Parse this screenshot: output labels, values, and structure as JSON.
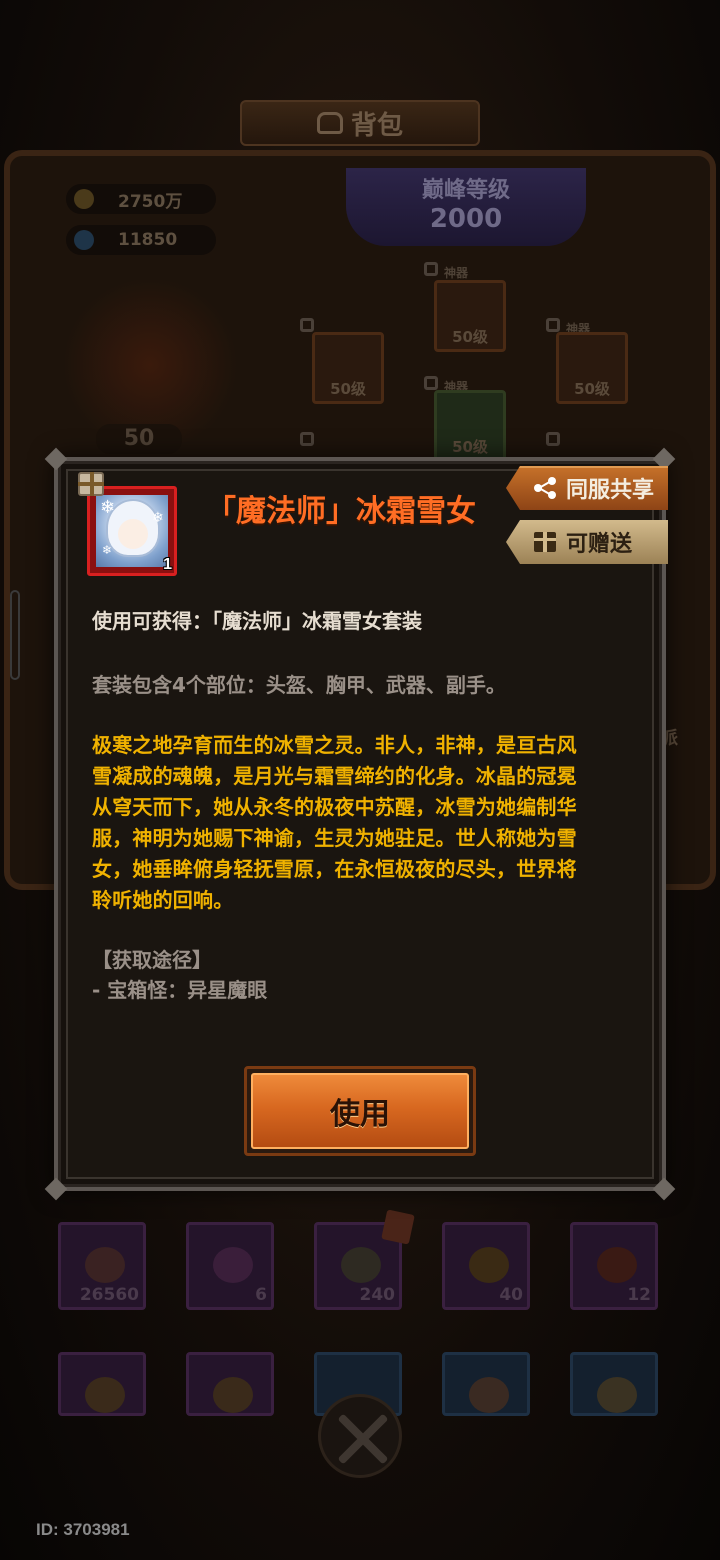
{
  "background": {
    "title": "背包",
    "currency": {
      "gold": "2750万",
      "gems": "11850"
    },
    "peak_level": {
      "label": "巅峰等级",
      "value": "2000"
    },
    "hero_level": "50",
    "equipment_slots": [
      {
        "tag": "神器",
        "level": "50级"
      },
      {
        "tag": "",
        "level": "50级"
      },
      {
        "tag": "神器",
        "level": "50级"
      },
      {
        "tag": "神器",
        "level": "50级"
      },
      {
        "tag": "",
        "level": "50级"
      }
    ],
    "side_text": "派",
    "inventory": [
      {
        "count": "26560",
        "kind": "purple"
      },
      {
        "count": "6",
        "kind": "purple"
      },
      {
        "count": "240",
        "kind": "purple"
      },
      {
        "count": "40",
        "kind": "purple"
      },
      {
        "count": "12",
        "kind": "purple"
      }
    ],
    "player_id": "ID: 3703981"
  },
  "dialog": {
    "item_title": "「魔法师」冰霜雪女",
    "item_count": "1",
    "share_label": "同服共享",
    "gift_label": "可赠送",
    "use_text": "使用可获得：「魔法师」冰霜雪女套装",
    "parts_text": "套装包含4个部位：头盔、胸甲、武器、副手。",
    "lore_lines": [
      "极寒之地孕育而生的冰雪之灵。非人，非神，是亘古风",
      "雪凝成的魂魄，是月光与霜雪缔约的化身。冰晶的冠冕",
      "从穹天而下，她从永冬的极夜中苏醒，冰雪为她编制华",
      "服，神明为她赐下神谕，生灵为她驻足。世人称她为雪",
      "女，她垂眸俯身轻抚雪原，在永恒极夜的尽头，世界将",
      "聆听她的回响。"
    ],
    "source_heading": "【获取途径】",
    "source_line": "- 宝箱怪：异星魔眼",
    "use_button_label": "使用"
  },
  "colors": {
    "title_orange": "#ff6d24",
    "lore_gold": "#f0b200",
    "rarity_red": "#d82020"
  }
}
